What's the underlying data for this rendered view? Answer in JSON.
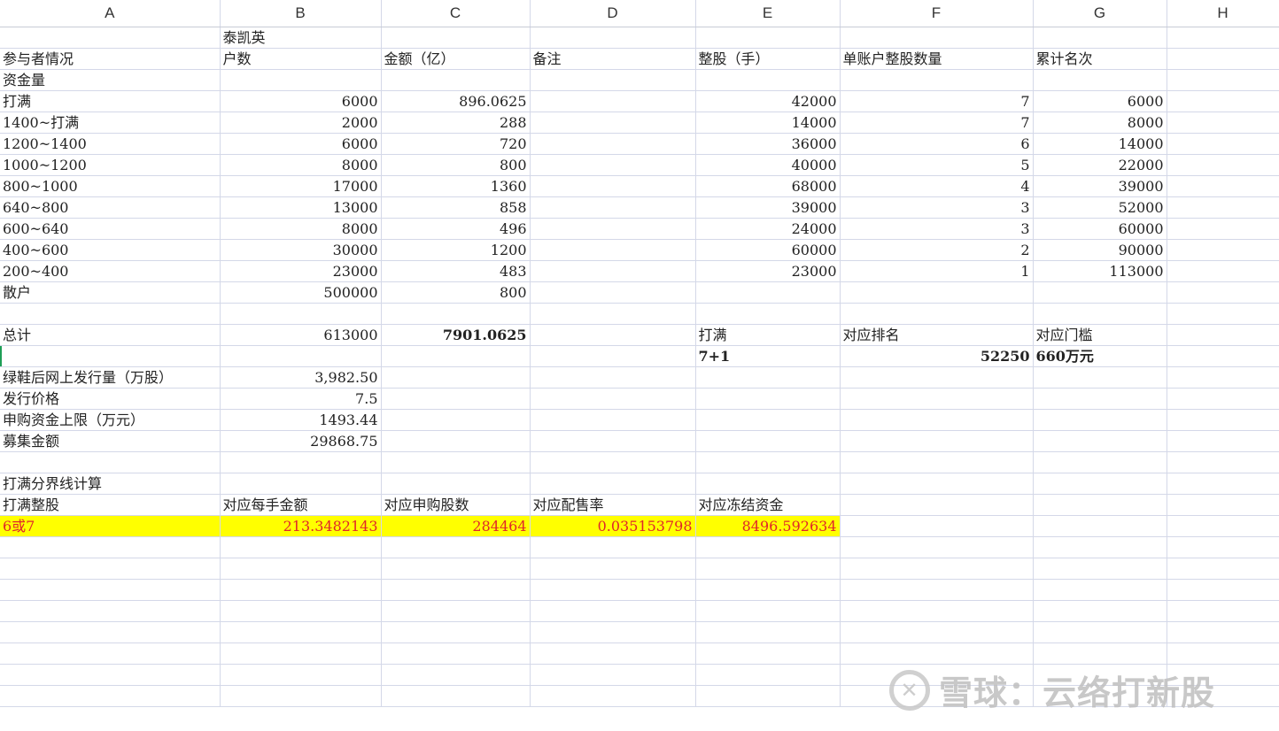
{
  "columns": [
    "A",
    "B",
    "C",
    "D",
    "E",
    "F",
    "G",
    "H"
  ],
  "rows": [
    [
      "",
      "泰凯英",
      "",
      "",
      "",
      "",
      "",
      ""
    ],
    [
      "参与者情况",
      "户数",
      "金额（亿）",
      "备注",
      "整股（手）",
      "单账户整股数量",
      "累计名次",
      ""
    ],
    [
      "资金量",
      "",
      "",
      "",
      "",
      "",
      "",
      ""
    ],
    [
      "打满",
      "6000",
      "896.0625",
      "",
      "42000",
      "7",
      "6000",
      ""
    ],
    [
      "1400~打满",
      "2000",
      "288",
      "",
      "14000",
      "7",
      "8000",
      ""
    ],
    [
      "1200~1400",
      "6000",
      "720",
      "",
      "36000",
      "6",
      "14000",
      ""
    ],
    [
      "1000~1200",
      "8000",
      "800",
      "",
      "40000",
      "5",
      "22000",
      ""
    ],
    [
      "800~1000",
      "17000",
      "1360",
      "",
      "68000",
      "4",
      "39000",
      ""
    ],
    [
      "640~800",
      "13000",
      "858",
      "",
      "39000",
      "3",
      "52000",
      ""
    ],
    [
      "600~640",
      "8000",
      "496",
      "",
      "24000",
      "3",
      "60000",
      ""
    ],
    [
      "400~600",
      "30000",
      "1200",
      "",
      "60000",
      "2",
      "90000",
      ""
    ],
    [
      "200~400",
      "23000",
      "483",
      "",
      "23000",
      "1",
      "113000",
      ""
    ],
    [
      "散户",
      "500000",
      "800",
      "",
      "",
      "",
      "",
      ""
    ],
    [
      "",
      "",
      "",
      "",
      "",
      "",
      "",
      ""
    ],
    [
      "总计",
      "613000",
      "7901.0625",
      "",
      "打满",
      "对应排名",
      "对应门槛",
      ""
    ],
    [
      "",
      "",
      "",
      "",
      "7+1",
      "52250",
      "660万元",
      ""
    ],
    [
      "绿鞋后网上发行量（万股）",
      "3,982.50",
      "",
      "",
      "",
      "",
      "",
      ""
    ],
    [
      "发行价格",
      "7.5",
      "",
      "",
      "",
      "",
      "",
      ""
    ],
    [
      "申购资金上限（万元）",
      "1493.44",
      "",
      "",
      "",
      "",
      "",
      ""
    ],
    [
      "募集金额",
      "29868.75",
      "",
      "",
      "",
      "",
      "",
      ""
    ],
    [
      "",
      "",
      "",
      "",
      "",
      "",
      "",
      ""
    ],
    [
      "打满分界线计算",
      "",
      "",
      "",
      "",
      "",
      "",
      ""
    ],
    [
      "打满整股",
      "对应每手金额",
      "对应申购股数",
      "对应配售率",
      "对应冻结资金",
      "",
      "",
      ""
    ],
    [
      "6或7",
      "213.3482143",
      "284464",
      "0.035153798",
      "8496.592634",
      "",
      "",
      ""
    ],
    [
      "",
      "",
      "",
      "",
      "",
      "",
      "",
      ""
    ],
    [
      "",
      "",
      "",
      "",
      "",
      "",
      "",
      ""
    ],
    [
      "",
      "",
      "",
      "",
      "",
      "",
      "",
      ""
    ],
    [
      "",
      "",
      "",
      "",
      "",
      "",
      "",
      ""
    ],
    [
      "",
      "",
      "",
      "",
      "",
      "",
      "",
      ""
    ],
    [
      "",
      "",
      "",
      "",
      "",
      "",
      "",
      ""
    ],
    [
      "",
      "",
      "",
      "",
      "",
      "",
      "",
      ""
    ],
    [
      "",
      "",
      "",
      "",
      "",
      "",
      "",
      ""
    ]
  ],
  "watermark": {
    "logo_glyph": "✕",
    "text": "雪球：云络打新股"
  },
  "colors": {
    "highlight_fill": "#ffff00",
    "highlight_text": "#e0262a",
    "grid": "#d4d8e8"
  }
}
